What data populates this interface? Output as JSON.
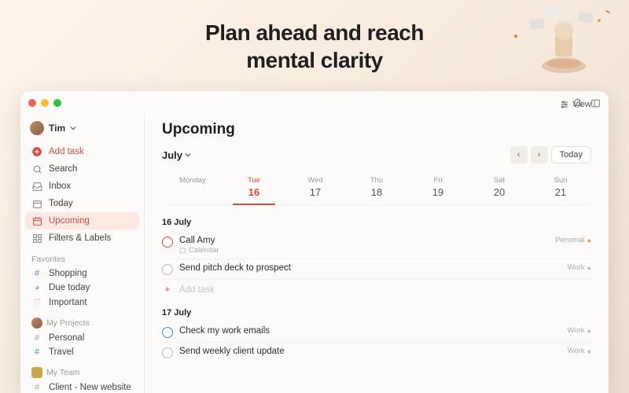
{
  "hero": {
    "line1": "Plan ahead and reach",
    "line2": "mental clarity"
  },
  "view_label": "View",
  "user": {
    "name": "Tim"
  },
  "sidebar": {
    "add_task": "Add task",
    "search": "Search",
    "inbox": "Inbox",
    "today": "Today",
    "upcoming": "Upcoming",
    "filters": "Filters & Labels",
    "favorites_label": "Favorites",
    "favorites": [
      {
        "label": "Shopping",
        "color": "blue"
      },
      {
        "label": "Due today",
        "color": "gray"
      },
      {
        "label": "Important",
        "color": "heart"
      }
    ],
    "my_projects_label": "My Projects",
    "my_projects": [
      {
        "label": "Personal",
        "color": "gray"
      },
      {
        "label": "Travel",
        "color": "green"
      }
    ],
    "my_team_label": "My Team",
    "my_team": [
      {
        "label": "Client - New website",
        "color": "gray"
      }
    ]
  },
  "main": {
    "title": "Upcoming",
    "month": "July",
    "today_btn": "Today",
    "days": [
      {
        "name": "Monday",
        "num": ""
      },
      {
        "name": "Tue",
        "num": "16",
        "selected": true
      },
      {
        "name": "Wed",
        "num": "17"
      },
      {
        "name": "Thu",
        "num": "18"
      },
      {
        "name": "Fri",
        "num": "19"
      },
      {
        "name": "Sat",
        "num": "20"
      },
      {
        "name": "Sun",
        "num": "21"
      }
    ],
    "sections": [
      {
        "label": "16 July",
        "tasks": [
          {
            "title": "Call Amy",
            "meta": "Calendar",
            "tag": "Personal",
            "check": "red"
          },
          {
            "title": "Send pitch deck to prospect",
            "meta": "",
            "tag": "Work",
            "check": "gray"
          }
        ],
        "show_add": true
      },
      {
        "label": "17 July",
        "tasks": [
          {
            "title": "Check my work emails",
            "meta": "",
            "tag": "Work",
            "check": "blue"
          },
          {
            "title": "Send weekly client update",
            "meta": "",
            "tag": "Work",
            "check": "gray"
          }
        ],
        "show_add": false
      }
    ],
    "add_task_label": "Add task"
  }
}
